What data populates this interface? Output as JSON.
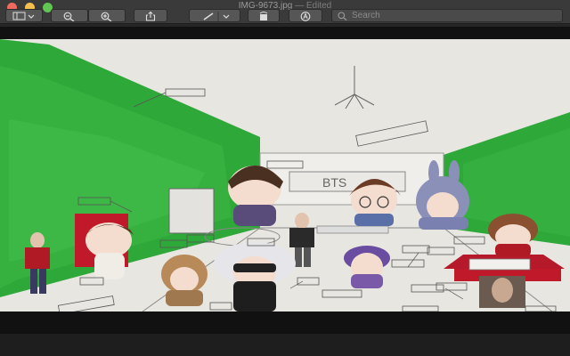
{
  "window": {
    "filename": "IMG-9673.jpg",
    "status": "— Edited"
  },
  "toolbar": {
    "search_placeholder": "Search"
  },
  "photo": {
    "sign_text": "BTS"
  },
  "colors": {
    "titlebar": "#3a3a3a",
    "toolbar_button": "#565656",
    "wall_green": "#2fa83a",
    "close": "#ed6a5e",
    "minimize": "#f5bf4f",
    "zoom": "#61c454"
  }
}
